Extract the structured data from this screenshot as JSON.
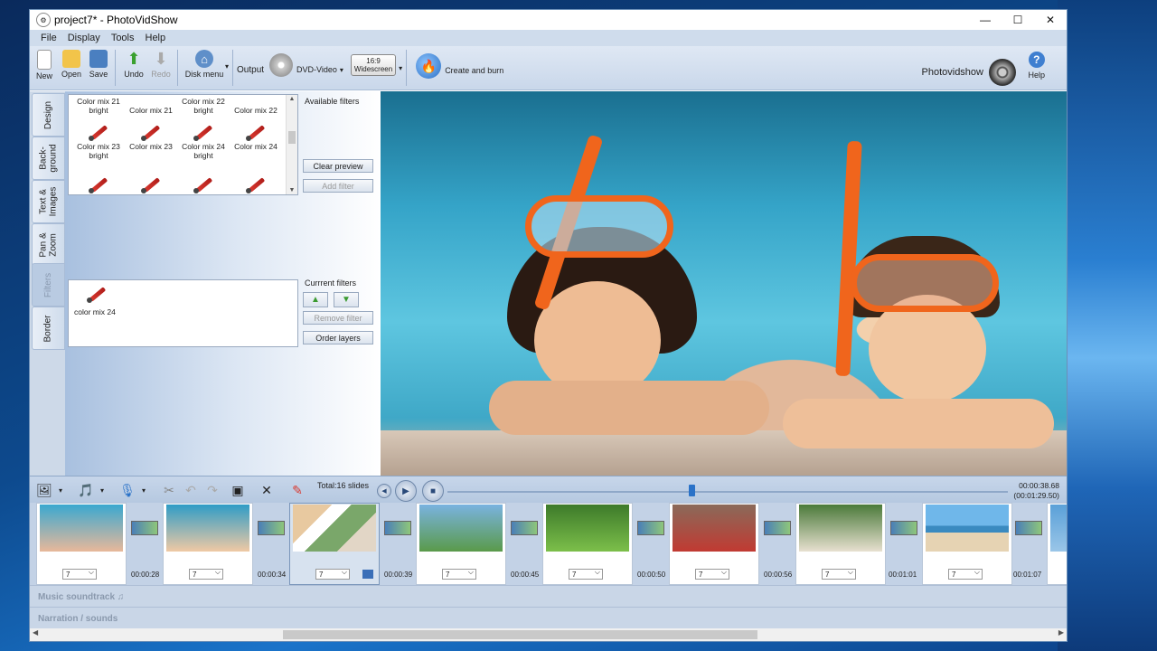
{
  "window": {
    "title": "project7* - PhotoVidShow"
  },
  "menu": [
    "File",
    "Display",
    "Tools",
    "Help"
  ],
  "toolbar": {
    "new": "New",
    "open": "Open",
    "save": "Save",
    "undo": "Undo",
    "redo": "Redo",
    "disk_menu": "Disk menu",
    "output": "Output",
    "dvd_video": "DVD-Video",
    "aspect_top": "16:9",
    "aspect_bottom": "Widescreen",
    "create_burn": "Create and burn",
    "brand": "Photovidshow",
    "help": "Help"
  },
  "side_tabs": [
    "Design",
    "Back-\nground",
    "Text &\nImages",
    "Pan &\nZoom",
    "Filters",
    "Border"
  ],
  "filters_panel": {
    "available_label": "Available filters",
    "current_label": "Currrent filters",
    "clear_preview": "Clear preview",
    "add_filter": "Add filter",
    "remove_filter": "Remove filter",
    "order_layers": "Order layers",
    "top_row": [
      "Color mix 21\nbright",
      "Color mix 21",
      "Color mix 22\nbright",
      "Color mix 22"
    ],
    "row2": [
      "Color mix 23\nbright",
      "Color mix 23",
      "Color mix 24\nbright",
      "Color mix 24"
    ],
    "current_item": "color mix 24"
  },
  "timeline": {
    "total": "Total:16 slides",
    "time_current": "00:00:38.68",
    "time_total": "(00:01:29.50)",
    "playhead_fraction": 0.43
  },
  "slides": [
    {
      "dur": "7",
      "t": "00:00:28"
    },
    {
      "dur": "7",
      "t": "00:00:34"
    },
    {
      "dur": "7",
      "t": "00:00:39"
    },
    {
      "dur": "7",
      "t": "00:00:45"
    },
    {
      "dur": "7",
      "t": "00:00:50"
    },
    {
      "dur": "7",
      "t": "00:00:56"
    },
    {
      "dur": "7",
      "t": "00:01:01"
    },
    {
      "dur": "7",
      "t": "00:01:07"
    }
  ],
  "tracks": {
    "music": "Music  soundtrack ♫",
    "narration": "Narration / sounds"
  },
  "colors": {
    "accent": "#2a72c8",
    "panel": "#c9d6e7"
  }
}
